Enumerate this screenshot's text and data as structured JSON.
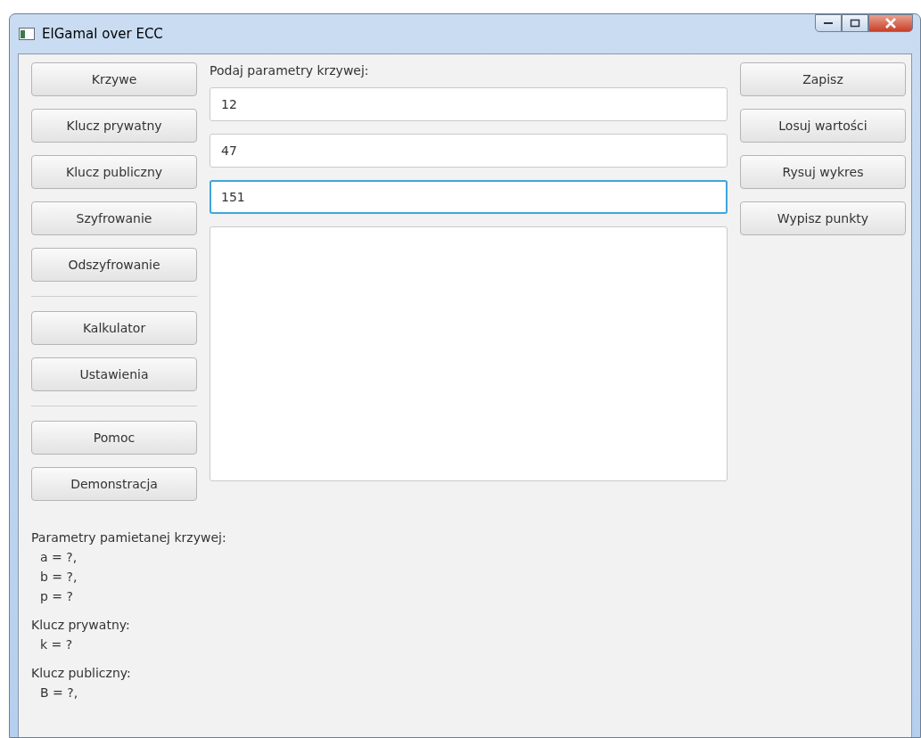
{
  "window": {
    "title": "ElGamal over ECC"
  },
  "navigation": {
    "groups": [
      {
        "buttons": [
          "Krzywe",
          "Klucz prywatny",
          "Klucz publiczny",
          "Szyfrowanie",
          "Odszyfrowanie"
        ]
      },
      {
        "buttons": [
          "Kalkulator",
          "Ustawienia"
        ]
      },
      {
        "buttons": [
          "Pomoc",
          "Demonstracja"
        ]
      }
    ]
  },
  "prompt": "Podaj parametry krzywej:",
  "fields": [
    {
      "value": "12",
      "focused": false
    },
    {
      "value": "47",
      "focused": false
    },
    {
      "value": "151",
      "focused": true
    }
  ],
  "actions": [
    "Zapisz",
    "Losuj wartości",
    "Rysuj wykres",
    "Wypisz punkty"
  ],
  "memory": [
    {
      "heading": "Parametry pamietanej krzywej:",
      "lines": [
        "a = ?,",
        "b = ?,",
        "p = ?"
      ]
    },
    {
      "heading": "Klucz prywatny:",
      "lines": [
        "k = ?"
      ]
    },
    {
      "heading": "Klucz publiczny:",
      "lines": [
        "B = ?,"
      ]
    }
  ]
}
